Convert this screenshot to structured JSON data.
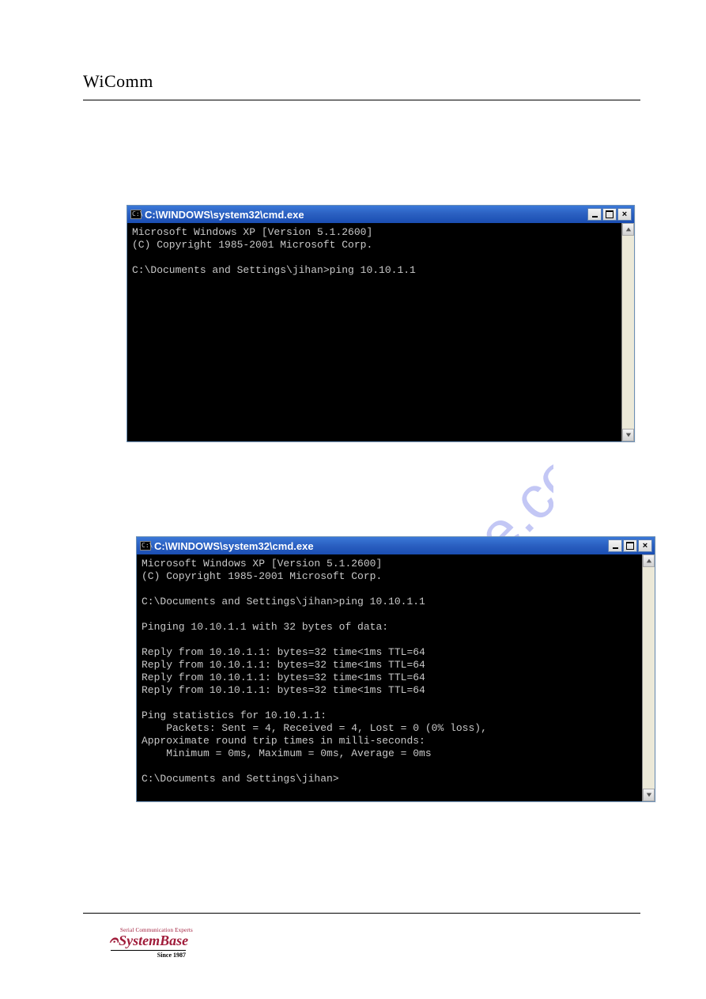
{
  "header": {
    "brand": "WiComm"
  },
  "watermark": "manualshive.com",
  "footer": {
    "tagline": "Serial Communication Experts",
    "brand": "SystemBase",
    "since": "Since 1987"
  },
  "cmd1": {
    "title": "C:\\WINDOWS\\system32\\cmd.exe",
    "icon": "cmd-icon",
    "lines": [
      "Microsoft Windows XP [Version 5.1.2600]",
      "(C) Copyright 1985-2001 Microsoft Corp.",
      "",
      "C:\\Documents and Settings\\jihan>ping 10.10.1.1"
    ]
  },
  "cmd2": {
    "title": "C:\\WINDOWS\\system32\\cmd.exe",
    "icon": "cmd-icon",
    "lines": [
      "Microsoft Windows XP [Version 5.1.2600]",
      "(C) Copyright 1985-2001 Microsoft Corp.",
      "",
      "C:\\Documents and Settings\\jihan>ping 10.10.1.1",
      "",
      "Pinging 10.10.1.1 with 32 bytes of data:",
      "",
      "Reply from 10.10.1.1: bytes=32 time<1ms TTL=64",
      "Reply from 10.10.1.1: bytes=32 time<1ms TTL=64",
      "Reply from 10.10.1.1: bytes=32 time<1ms TTL=64",
      "Reply from 10.10.1.1: bytes=32 time<1ms TTL=64",
      "",
      "Ping statistics for 10.10.1.1:",
      "    Packets: Sent = 4, Received = 4, Lost = 0 (0% loss),",
      "Approximate round trip times in milli-seconds:",
      "    Minimum = 0ms, Maximum = 0ms, Average = 0ms",
      "",
      "C:\\Documents and Settings\\jihan>"
    ]
  },
  "icon_prefix": "C:\\"
}
